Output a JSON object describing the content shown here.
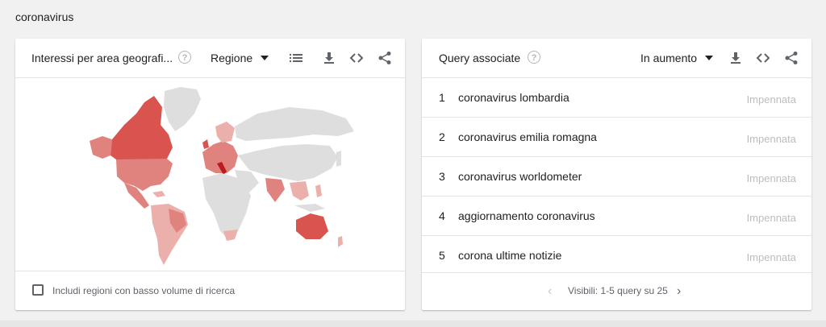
{
  "search_term": "coronavirus",
  "colors": {
    "map_strong": "#d9534f",
    "map_medium": "#e0837e",
    "map_light": "#ebb0ab",
    "map_none": "#dedede",
    "italy": "#b81d1d",
    "background": "#f1f1f1"
  },
  "left_card": {
    "title": "Interessi per area geografi...",
    "help_icon": "help-icon",
    "dropdown_label": "Regione",
    "tools": [
      "list-icon",
      "download-icon",
      "embed-icon",
      "share-icon"
    ],
    "checkbox_label": "Includi regioni con basso volume di ricerca",
    "checkbox_checked": false
  },
  "right_card": {
    "title": "Query associate",
    "help_icon": "help-icon",
    "dropdown_label": "In aumento",
    "tools": [
      "download-icon",
      "embed-icon",
      "share-icon"
    ],
    "queries": [
      {
        "rank": "1",
        "text": "coronavirus lombardia",
        "value": "Impennata"
      },
      {
        "rank": "2",
        "text": "coronavirus emilia romagna",
        "value": "Impennata"
      },
      {
        "rank": "3",
        "text": "coronavirus worldometer",
        "value": "Impennata"
      },
      {
        "rank": "4",
        "text": "aggiornamento coronavirus",
        "value": "Impennata"
      },
      {
        "rank": "5",
        "text": "corona ultime notizie",
        "value": "Impennata"
      }
    ],
    "pager_text": "Visibili: 1-5 query su 25"
  }
}
